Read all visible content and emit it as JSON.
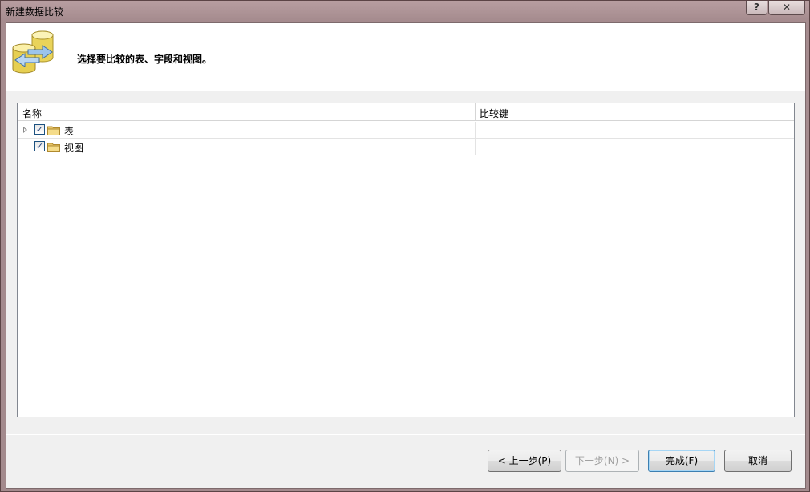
{
  "window": {
    "title": "新建数据比较",
    "help_label": "?",
    "close_label": "✕"
  },
  "header": {
    "instruction": "选择要比较的表、字段和视图。",
    "icon": "database-compare-icon"
  },
  "grid": {
    "columns": [
      "名称",
      "比较键"
    ],
    "rows": [
      {
        "label": "表",
        "checked": true,
        "expandable": true,
        "icon": "folder-icon"
      },
      {
        "label": "视图",
        "checked": true,
        "expandable": false,
        "icon": "folder-icon"
      }
    ]
  },
  "buttons": {
    "back": "< 上一步(P)",
    "next": "下一步(N) >",
    "finish": "完成(F)",
    "cancel": "取消"
  },
  "colors": {
    "frame": "#a38a8d",
    "client": "#f0f0f0",
    "header_bg": "#ffffff",
    "folder": "#e8c56a"
  }
}
